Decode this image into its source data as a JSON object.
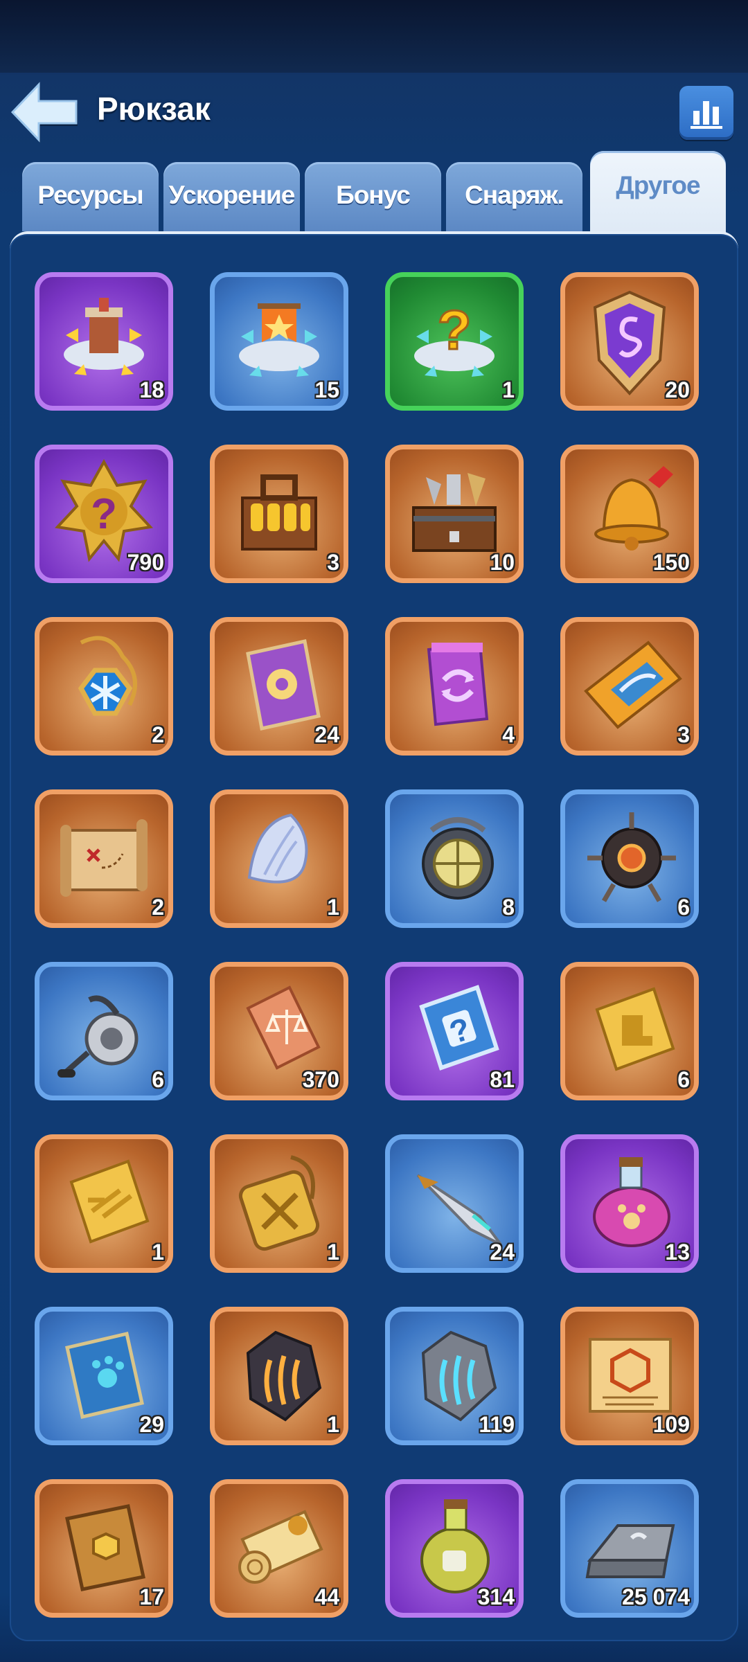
{
  "header": {
    "title": "Рюкзак",
    "back_icon": "back-arrow-icon",
    "stats_icon": "bar-chart-icon"
  },
  "tabs": [
    {
      "label": "Ресурсы",
      "active": false
    },
    {
      "label": "Ускорение",
      "active": false
    },
    {
      "label": "Бонус",
      "active": false
    },
    {
      "label": "Снаряж.",
      "active": false
    },
    {
      "label": "Другое",
      "active": true
    }
  ],
  "colors": {
    "orange_frame": "#f0a066",
    "blue_frame": "#6aa6ec",
    "purple_frame": "#b87bf0",
    "green_frame": "#46d25a"
  },
  "items": [
    {
      "name": "tower-relocate-icon",
      "rarity": "purple",
      "count": "18"
    },
    {
      "name": "banner-relocate-icon",
      "rarity": "blue",
      "count": "15"
    },
    {
      "name": "random-relocate-icon",
      "rarity": "green",
      "count": "1"
    },
    {
      "name": "rune-shield-icon",
      "rarity": "orange",
      "count": "20"
    },
    {
      "name": "mystery-badge-icon",
      "rarity": "purple",
      "count": "790"
    },
    {
      "name": "potion-crate-icon",
      "rarity": "orange",
      "count": "3"
    },
    {
      "name": "tool-chest-icon",
      "rarity": "orange",
      "count": "10"
    },
    {
      "name": "golden-bell-icon",
      "rarity": "orange",
      "count": "150"
    },
    {
      "name": "frost-amulet-icon",
      "rarity": "orange",
      "count": "2"
    },
    {
      "name": "purple-card-icon",
      "rarity": "orange",
      "count": "24"
    },
    {
      "name": "swap-ticket-icon",
      "rarity": "orange",
      "count": "4"
    },
    {
      "name": "fish-ticket-icon",
      "rarity": "orange",
      "count": "3"
    },
    {
      "name": "treasure-map-icon",
      "rarity": "orange",
      "count": "2"
    },
    {
      "name": "seashell-icon",
      "rarity": "orange",
      "count": "1"
    },
    {
      "name": "diving-helmet-icon",
      "rarity": "blue",
      "count": "8"
    },
    {
      "name": "robot-drone-icon",
      "rarity": "blue",
      "count": "6"
    },
    {
      "name": "fishing-reel-icon",
      "rarity": "blue",
      "count": "6"
    },
    {
      "name": "justice-ticket-icon",
      "rarity": "orange",
      "count": "370"
    },
    {
      "name": "mystery-card-icon",
      "rarity": "purple",
      "count": "81"
    },
    {
      "name": "gold-boot-ticket-icon",
      "rarity": "orange",
      "count": "6"
    },
    {
      "name": "gold-speed-ticket-icon",
      "rarity": "orange",
      "count": "1"
    },
    {
      "name": "sword-medal-icon",
      "rarity": "orange",
      "count": "1"
    },
    {
      "name": "crystal-dart-icon",
      "rarity": "blue",
      "count": "24"
    },
    {
      "name": "paw-potion-icon",
      "rarity": "purple",
      "count": "13"
    },
    {
      "name": "paw-book-icon",
      "rarity": "blue",
      "count": "29"
    },
    {
      "name": "fire-claw-stone-icon",
      "rarity": "orange",
      "count": "1"
    },
    {
      "name": "ice-claw-stone-icon",
      "rarity": "blue",
      "count": "119"
    },
    {
      "name": "hex-scroll-icon",
      "rarity": "orange",
      "count": "109"
    },
    {
      "name": "gem-tome-icon",
      "rarity": "orange",
      "count": "17"
    },
    {
      "name": "rolled-scroll-icon",
      "rarity": "orange",
      "count": "44"
    },
    {
      "name": "oil-bottle-icon",
      "rarity": "purple",
      "count": "314"
    },
    {
      "name": "silver-ingot-icon",
      "rarity": "blue",
      "count": "25 074"
    }
  ]
}
